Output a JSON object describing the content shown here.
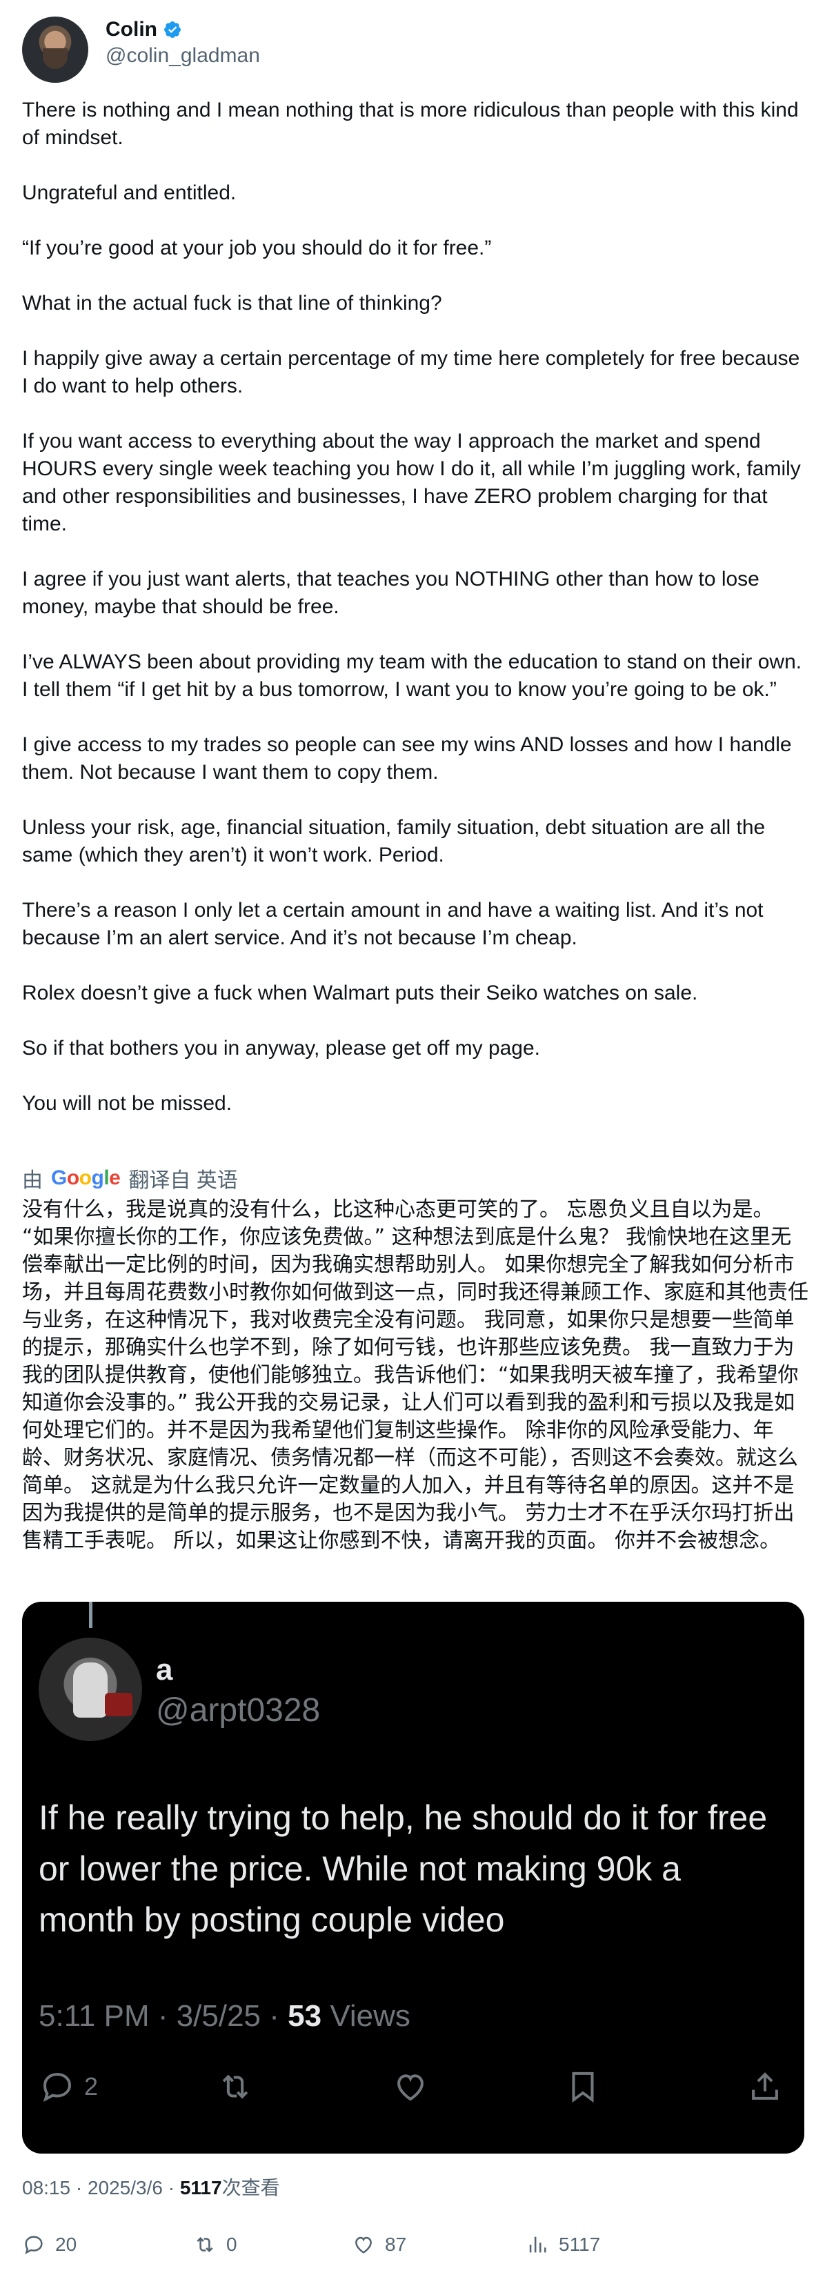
{
  "author": {
    "name": "Colin",
    "handle": "@colin_gladman"
  },
  "post": {
    "paragraphs": [
      "There is nothing and I mean nothing that is more ridiculous than people with this kind of mindset.",
      "Ungrateful and entitled.",
      "“If you’re good at your job you should do it for free.”",
      "What in the actual fuck is that line of thinking?",
      "I happily give away a certain percentage of my time here completely for free because I do want to help others.",
      "If you want access to everything about the way I approach the market and spend HOURS every single week teaching you how I do it, all while I’m juggling work, family and other responsibilities and businesses, I have ZERO problem charging for that time.",
      "I agree if you just want alerts, that teaches you NOTHING other than how to lose money, maybe that should be free.",
      "I’ve ALWAYS been about providing my team with the education to stand on their own. I tell them “if I get hit by a bus tomorrow, I want you to know you’re going to be ok.”",
      "I give access to my trades so people can see my wins AND losses and how I handle them. Not because I want them to copy them.",
      "Unless your risk, age, financial situation, family situation, debt situation are all the same (which they aren’t) it won’t work. Period.",
      "There’s a reason I only let a certain amount in and have a waiting list. And it’s not because I’m an alert service. And it’s not because I’m cheap.",
      "Rolex doesn’t give a fuck when Walmart puts their Seiko watches on sale.",
      "So if that bothers you in anyway, please get off my page.",
      "You will not be missed."
    ]
  },
  "translation": {
    "prefix": "由",
    "google_letters": [
      "G",
      "o",
      "o",
      "g",
      "l",
      "e"
    ],
    "suffix": "翻译自 英语",
    "text": "没有什么，我是说真的没有什么，比这种心态更可笑的了。 忘恩负义且自以为是。 “如果你擅长你的工作，你应该免费做。” 这种想法到底是什么鬼？ 我愉快地在这里无偿奉献出一定比例的时间，因为我确实想帮助别人。 如果你想完全了解我如何分析市场，并且每周花费数小时教你如何做到这一点，同时我还得兼顾工作、家庭和其他责任与业务，在这种情况下，我对收费完全没有问题。 我同意，如果你只是想要一些简单的提示，那确实什么也学不到，除了如何亏钱，也许那些应该免费。 我一直致力于为我的团队提供教育，使他们能够独立。我告诉他们：“如果我明天被车撞了，我希望你知道你会没事的。” 我公开我的交易记录，让人们可以看到我的盈利和亏损以及我是如何处理它们的。并不是因为我希望他们复制这些操作。 除非你的风险承受能力、年龄、财务状况、家庭情况、债务情况都一样（而这不可能），否则这不会奏效。就这么简单。 这就是为什么我只允许一定数量的人加入，并且有等待名单的原因。这并不是因为我提供的是简单的提示服务，也不是因为我小气。 劳力士才不在乎沃尔玛打折出售精工手表呢。 所以，如果这让你感到不快，请离开我的页面。 你并不会被想念。"
  },
  "quoted": {
    "name": "a",
    "handle": "@arpt0328",
    "text": "If he really trying to help, he should do it for free or lower the price. While not making 90k a month by posting couple video",
    "time": "5:11 PM · 3/5/25 · ",
    "views_count": "53",
    "views_label": " Views",
    "replies": "2"
  },
  "meta": {
    "time": "08:15 · 2025/3/6 · ",
    "views_count": "5117",
    "views_label": "次查看"
  },
  "stats": {
    "replies": "20",
    "reposts": "0",
    "likes": "87",
    "views": "5117"
  },
  "colors": {
    "verified": "#1d9bf0",
    "secondary_text": "#536471",
    "quote_bg": "#000000"
  }
}
